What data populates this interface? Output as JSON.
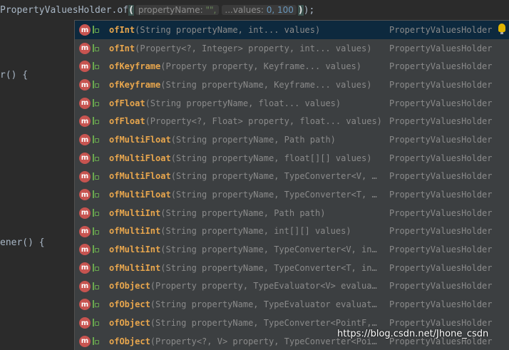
{
  "editor": {
    "line_prefix": "PropertyValuesHolder.",
    "line_method": "of",
    "open_paren": "(",
    "hint_property_name_label": "propertyName:",
    "hint_property_name_value": "\"\",",
    "hint_values_label": "...values:",
    "hint_values_value": "0, 100",
    "close_paren": ")",
    "line_suffix": ");",
    "side_code_1": "r() {",
    "side_code_2": "ener() {"
  },
  "completion": {
    "items": [
      {
        "name": "ofInt",
        "signature": "(String propertyName, int... values)",
        "type": "PropertyValuesHolder"
      },
      {
        "name": "ofInt",
        "signature": "(Property<?, Integer> property, int... values)",
        "type": "PropertyValuesHolder"
      },
      {
        "name": "ofKeyframe",
        "signature": "(Property property, Keyframe... values)",
        "type": "PropertyValuesHolder"
      },
      {
        "name": "ofKeyframe",
        "signature": "(String propertyName, Keyframe... values)",
        "type": "PropertyValuesHolder"
      },
      {
        "name": "ofFloat",
        "signature": "(String propertyName, float... values)",
        "type": "PropertyValuesHolder"
      },
      {
        "name": "ofFloat",
        "signature": "(Property<?, Float> property, float... values)",
        "type": "PropertyValuesHolder"
      },
      {
        "name": "ofMultiFloat",
        "signature": "(String propertyName, Path path)",
        "type": "PropertyValuesHolder"
      },
      {
        "name": "ofMultiFloat",
        "signature": "(String propertyName, float[][] values)",
        "type": "PropertyValuesHolder"
      },
      {
        "name": "ofMultiFloat",
        "signature": "(String propertyName, TypeConverter<V, …",
        "type": "PropertyValuesHolder"
      },
      {
        "name": "ofMultiFloat",
        "signature": "(String propertyName, TypeConverter<T, …",
        "type": "PropertyValuesHolder"
      },
      {
        "name": "ofMultiInt",
        "signature": "(String propertyName, Path path)",
        "type": "PropertyValuesHolder"
      },
      {
        "name": "ofMultiInt",
        "signature": "(String propertyName, int[][] values)",
        "type": "PropertyValuesHolder"
      },
      {
        "name": "ofMultiInt",
        "signature": "(String propertyName, TypeConverter<V, in…",
        "type": "PropertyValuesHolder"
      },
      {
        "name": "ofMultiInt",
        "signature": "(String propertyName, TypeConverter<T, in…",
        "type": "PropertyValuesHolder"
      },
      {
        "name": "ofObject",
        "signature": "(Property property, TypeEvaluator<V> evalua…",
        "type": "PropertyValuesHolder"
      },
      {
        "name": "ofObject",
        "signature": "(String propertyName, TypeEvaluator evaluat…",
        "type": "PropertyValuesHolder"
      },
      {
        "name": "ofObject",
        "signature": "(String propertyName, TypeConverter<PointF,…",
        "type": "PropertyValuesHolder"
      },
      {
        "name": "ofObject",
        "signature": "(Property<?, V> property, TypeConverter<Poi…",
        "type": "PropertyValuesHolder"
      }
    ],
    "method_icon_letter": "m",
    "selected_index": 0
  },
  "watermark": "https://blog.csdn.net/Jhone_csdn",
  "colors": {
    "background": "#2b2b2b",
    "popup_background": "#3c3f41",
    "selected_row": "#0d293e",
    "method_name": "#e8a64d",
    "method_icon": "#c75450",
    "visibility_icon": "#6aa84f"
  },
  "icons": {
    "method": "method-m-icon",
    "visibility": "public-visibility-icon",
    "hint": "lightbulb-icon"
  }
}
